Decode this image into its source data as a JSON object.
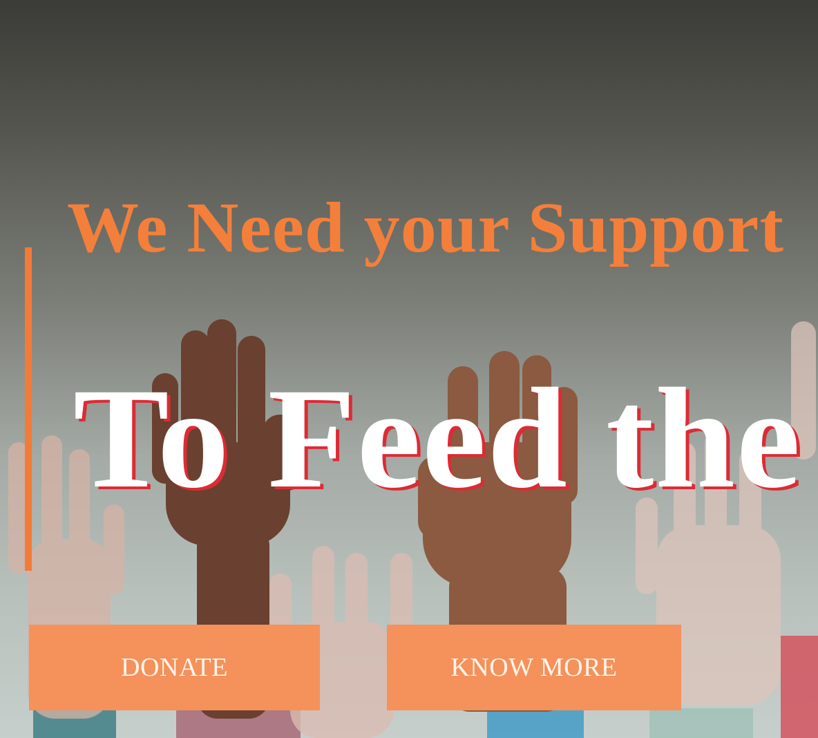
{
  "hero": {
    "tagline": "We Need your Support",
    "headline": "To Feed the",
    "colors": {
      "accent": "#f37b37",
      "headline_shadow": "#dc2b34",
      "button_bg": "#f5915a"
    }
  },
  "actions": {
    "donate_label": "DONATE",
    "know_more_label": "KNOW MORE"
  }
}
